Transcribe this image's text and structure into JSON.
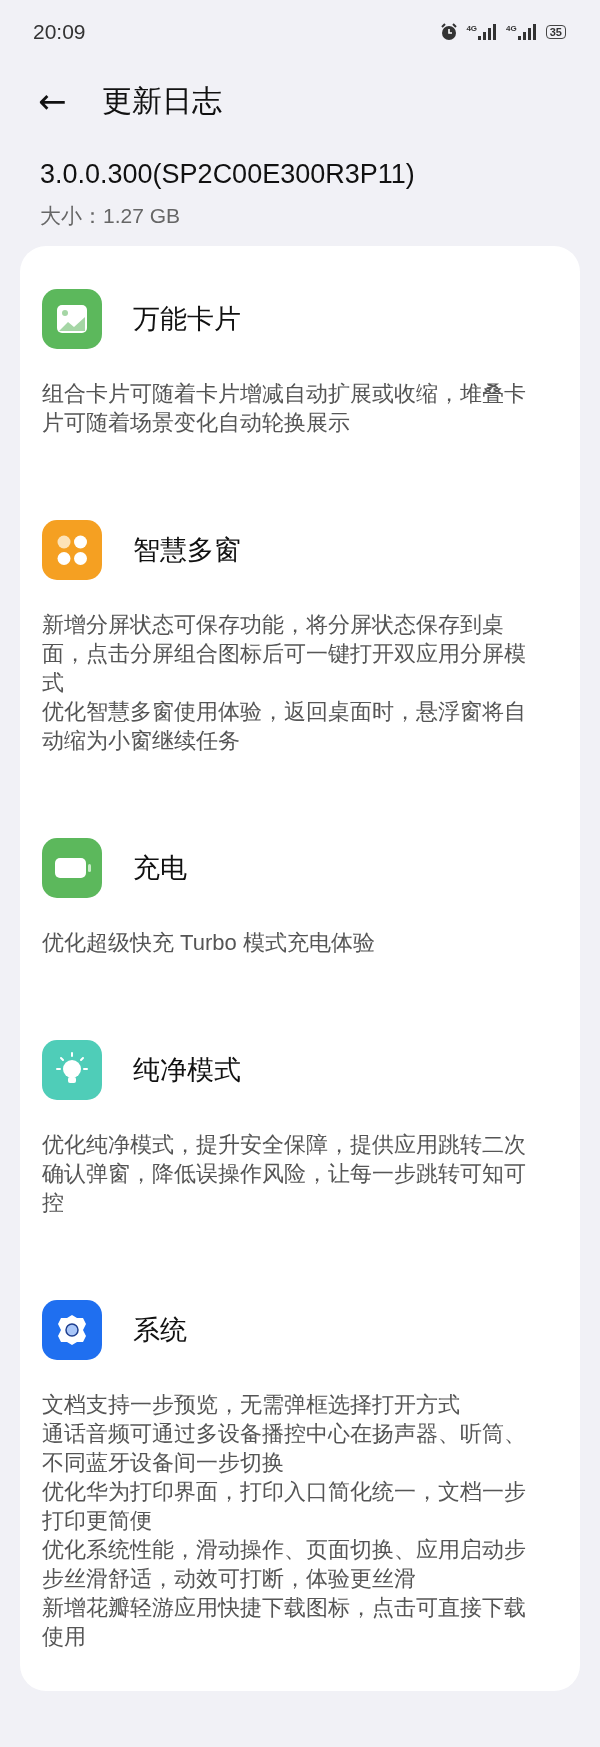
{
  "status_bar": {
    "time": "20:09",
    "networks": [
      "4G",
      "4G"
    ],
    "battery": "35"
  },
  "header": {
    "back": "←",
    "title": "更新日志"
  },
  "version": "3.0.0.300(SP2C00E300R3P11)",
  "size": "大小：1.27 GB",
  "sections": [
    {
      "kind": "gallery",
      "color": "#5cb85c",
      "title": "万能卡片",
      "paragraphs": [
        "组合卡片可随着卡片增减自动扩展或收缩，堆叠卡片可随着场景变化自动轮换展示"
      ]
    },
    {
      "kind": "windows",
      "color": "#f5a022",
      "title": "智慧多窗",
      "paragraphs": [
        "新增分屏状态可保存功能，将分屏状态保存到桌面，点击分屏组合图标后可一键打开双应用分屏模式",
        "优化智慧多窗使用体验，返回桌面时，悬浮窗将自动缩为小窗继续任务"
      ]
    },
    {
      "kind": "battery",
      "color": "#5cb85c",
      "title": "充电",
      "paragraphs": [
        "优化超级快充 Turbo 模式充电体验"
      ]
    },
    {
      "kind": "bulb",
      "color": "#4fcdb8",
      "title": "纯净模式",
      "paragraphs": [
        "优化纯净模式，提升安全保障，提供应用跳转二次确认弹窗，降低误操作风险，让每一步跳转可知可控"
      ]
    },
    {
      "kind": "gear",
      "color": "#1f6ff0",
      "title": "系统",
      "paragraphs": [
        "文档支持一步预览，无需弹框选择打开方式",
        "通话音频可通过多设备播控中心在扬声器、听筒、不同蓝牙设备间一步切换",
        "优化华为打印界面，打印入口简化统一，文档一步打印更简便",
        "优化系统性能，滑动操作、页面切换、应用启动步步丝滑舒适，动效可打断，体验更丝滑",
        "新增花瓣轻游应用快捷下载图标，点击可直接下载使用"
      ]
    }
  ]
}
